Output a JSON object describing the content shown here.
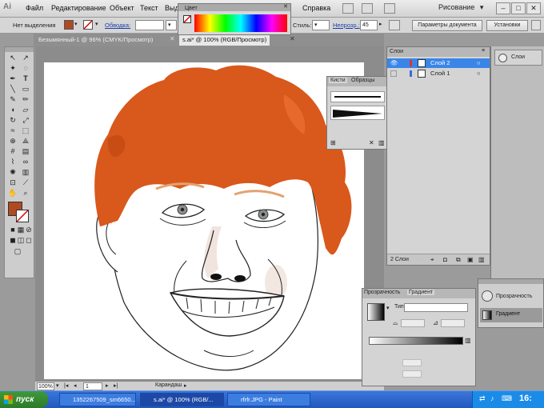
{
  "menubar": {
    "logo": "Ai",
    "items": [
      "Файл",
      "Редактирование",
      "Объект",
      "Текст",
      "Выд",
      "Справка"
    ],
    "workspace": "Рисование"
  },
  "controlbar": {
    "selection_label": "Нет выделения",
    "stroke_label": "Обводка:",
    "style_label": "Стиль:",
    "opacity_label": "Непрозр.:",
    "opacity_value": "45",
    "doc_params_button": "Параметры документа",
    "settings_button": "Установки"
  },
  "tabs": [
    {
      "label": "Безымянный-1 @ 96% (CMYK/Просмотр)",
      "active": false
    },
    {
      "label": "s.ai* @ 100% (RGB/Просмотр)",
      "active": true
    }
  ],
  "color_panel": {
    "title": "Цвет"
  },
  "brushes_panel": {
    "tabs": [
      "Кисти",
      "Образцы"
    ]
  },
  "layers_panel": {
    "title": "Слои",
    "layers": [
      "Слой 2",
      "Слой 1"
    ],
    "count": "2 Слои"
  },
  "gradient_panel": {
    "tabs": [
      "Прозрачность",
      "Градиент"
    ],
    "type_label": "Тип:"
  },
  "dock_panel": {
    "items": [
      "Прозрачность",
      "Градиент"
    ],
    "top_item": "Слои"
  },
  "statusbar": {
    "zoom": "100%",
    "page": "1",
    "tool": "Карандаш"
  },
  "taskbar": {
    "start": "пуск",
    "tasks": [
      {
        "label": "1352267509_sm6650...",
        "active": false
      },
      {
        "label": "s.ai* @ 100% (RGB/...",
        "active": true
      },
      {
        "label": "rfrfr.JPG - Paint",
        "active": false
      }
    ],
    "clock": "16:"
  },
  "colors": {
    "fill": "#b04a22",
    "hair": "#d9581b",
    "layer_selected": "#3a86e8"
  }
}
